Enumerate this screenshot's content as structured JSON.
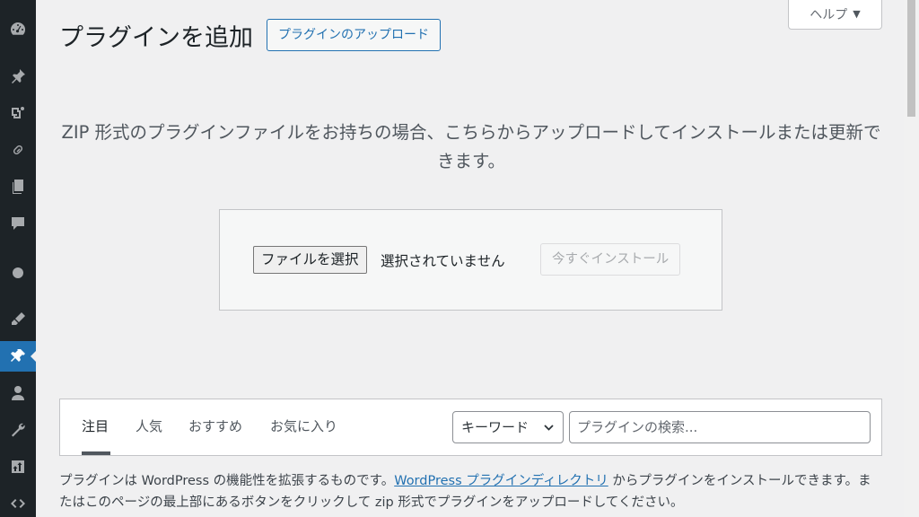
{
  "header": {
    "title": "プラグインを追加",
    "upload_button": "プラグインのアップロード",
    "help_tab": "ヘルプ"
  },
  "sidebar": {
    "items": [
      {
        "icon": "dashboard-icon"
      },
      {
        "icon": "posts-pin-icon"
      },
      {
        "icon": "media-icon"
      },
      {
        "icon": "links-icon"
      },
      {
        "icon": "pages-icon"
      },
      {
        "icon": "comments-icon"
      },
      {
        "icon": "circle-icon"
      },
      {
        "icon": "appearance-brush-icon"
      },
      {
        "icon": "plugins-icon",
        "active": true
      },
      {
        "icon": "users-icon"
      },
      {
        "icon": "tools-wrench-icon"
      },
      {
        "icon": "settings-icon"
      },
      {
        "icon": "code-icon"
      }
    ]
  },
  "upload": {
    "help_text": "ZIP 形式のプラグインファイルをお持ちの場合、こちらからアップロードしてインストールまたは更新できます。",
    "choose_file_button": "ファイルを選択",
    "file_status": "選択されていません",
    "install_button": "今すぐインストール"
  },
  "filters": {
    "tabs": [
      {
        "label": "注目",
        "current": true
      },
      {
        "label": "人気"
      },
      {
        "label": "おすすめ"
      },
      {
        "label": "お気に入り"
      }
    ],
    "search_type": "キーワード",
    "search_placeholder": "プラグインの検索..."
  },
  "description": {
    "part1": "プラグインは WordPress の機能性を拡張するものです。",
    "link": "WordPress プラグインディレクトリ",
    "part2": " からプラグインをインストールできます。またはこのページの最上部にあるボタンをクリックして zip 形式でプラグインをアップロードしてください。"
  },
  "colors": {
    "accent": "#2271b1",
    "sidebar_bg": "#1d2327",
    "page_bg": "#f0f0f1"
  }
}
